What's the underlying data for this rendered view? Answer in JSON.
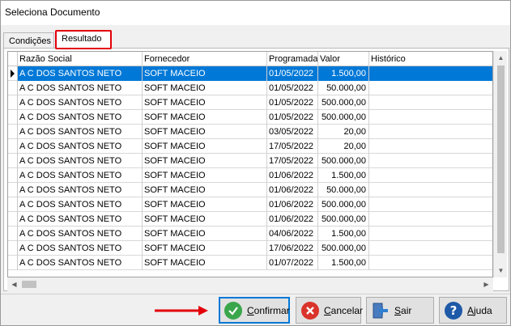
{
  "window": {
    "title": "Seleciona Documento"
  },
  "tabs": [
    {
      "label": "Condições"
    },
    {
      "label": "Resultado"
    }
  ],
  "grid": {
    "columns": [
      "Razão Social",
      "Fornecedor",
      "Programada",
      "Valor",
      "Histórico"
    ],
    "rows": [
      {
        "razao": "A C DOS SANTOS NETO",
        "fornecedor": "SOFT MACEIO",
        "programada": "01/05/2022",
        "valor": "1.500,00",
        "historico": ""
      },
      {
        "razao": "A C DOS SANTOS NETO",
        "fornecedor": "SOFT MACEIO",
        "programada": "01/05/2022",
        "valor": "50.000,00",
        "historico": ""
      },
      {
        "razao": "A C DOS SANTOS NETO",
        "fornecedor": "SOFT MACEIO",
        "programada": "01/05/2022",
        "valor": "500.000,00",
        "historico": ""
      },
      {
        "razao": "A C DOS SANTOS NETO",
        "fornecedor": "SOFT MACEIO",
        "programada": "01/05/2022",
        "valor": "500.000,00",
        "historico": ""
      },
      {
        "razao": "A C DOS SANTOS NETO",
        "fornecedor": "SOFT MACEIO",
        "programada": "03/05/2022",
        "valor": "20,00",
        "historico": ""
      },
      {
        "razao": "A C DOS SANTOS NETO",
        "fornecedor": "SOFT MACEIO",
        "programada": "17/05/2022",
        "valor": "20,00",
        "historico": ""
      },
      {
        "razao": "A C DOS SANTOS NETO",
        "fornecedor": "SOFT MACEIO",
        "programada": "17/05/2022",
        "valor": "500.000,00",
        "historico": ""
      },
      {
        "razao": "A C DOS SANTOS NETO",
        "fornecedor": "SOFT MACEIO",
        "programada": "01/06/2022",
        "valor": "1.500,00",
        "historico": ""
      },
      {
        "razao": "A C DOS SANTOS NETO",
        "fornecedor": "SOFT MACEIO",
        "programada": "01/06/2022",
        "valor": "50.000,00",
        "historico": ""
      },
      {
        "razao": "A C DOS SANTOS NETO",
        "fornecedor": "SOFT MACEIO",
        "programada": "01/06/2022",
        "valor": "500.000,00",
        "historico": ""
      },
      {
        "razao": "A C DOS SANTOS NETO",
        "fornecedor": "SOFT MACEIO",
        "programada": "01/06/2022",
        "valor": "500.000,00",
        "historico": ""
      },
      {
        "razao": "A C DOS SANTOS NETO",
        "fornecedor": "SOFT MACEIO",
        "programada": "04/06/2022",
        "valor": "1.500,00",
        "historico": ""
      },
      {
        "razao": "A C DOS SANTOS NETO",
        "fornecedor": "SOFT MACEIO",
        "programada": "17/06/2022",
        "valor": "500.000,00",
        "historico": ""
      },
      {
        "razao": "A C DOS SANTOS NETO",
        "fornecedor": "SOFT MACEIO",
        "programada": "01/07/2022",
        "valor": "1.500,00",
        "historico": ""
      }
    ],
    "selected_row": 0
  },
  "buttons": {
    "confirm": {
      "label": "Confirmar",
      "mnemonic": "C",
      "rest": "onfirmar"
    },
    "cancel": {
      "label": "Cancelar",
      "mnemonic": "C",
      "rest": "ancelar"
    },
    "exit": {
      "label": "Sair",
      "mnemonic": "S",
      "rest": "air"
    },
    "help": {
      "label": "Ajuda",
      "mnemonic": "A",
      "rest": "juda"
    }
  },
  "colors": {
    "selection": "#0078d7",
    "highlight_border": "#e3000b",
    "confirm_icon": "#3aa64b",
    "cancel_icon": "#d9342b",
    "help_icon": "#1e5aa8"
  },
  "icons": {
    "confirm": "check-circle-icon",
    "cancel": "x-circle-icon",
    "exit": "exit-door-icon",
    "help": "question-circle-icon"
  }
}
